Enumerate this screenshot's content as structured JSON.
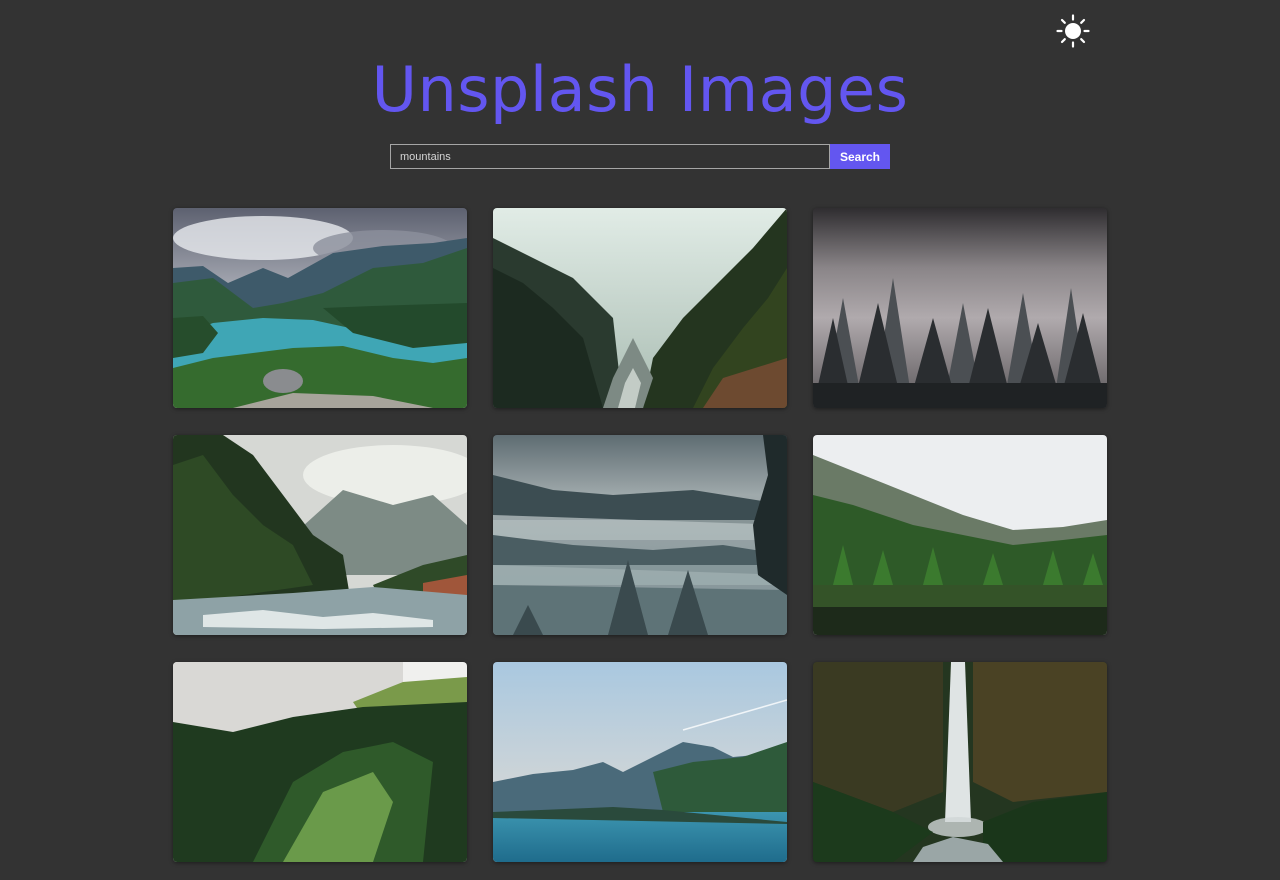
{
  "app": {
    "title": "Unsplash Images",
    "accent_color": "#6356f0"
  },
  "theme_toggle": {
    "icon": "sun-icon",
    "color": "#ffffff"
  },
  "search": {
    "value": "mountains",
    "placeholder": "Search",
    "button_label": "Search"
  },
  "gallery": {
    "images": [
      {
        "subject": "turquoise mountain lake under cloudy sky"
      },
      {
        "subject": "misty forest valley with river"
      },
      {
        "subject": "foggy pine forest"
      },
      {
        "subject": "pine forest beside rushing river"
      },
      {
        "subject": "layered misty forest hills"
      },
      {
        "subject": "green forest reflected in lake"
      },
      {
        "subject": "snowy peak above dense forest"
      },
      {
        "subject": "blue lake with distant mountains"
      },
      {
        "subject": "waterfall in green jungle"
      }
    ]
  }
}
